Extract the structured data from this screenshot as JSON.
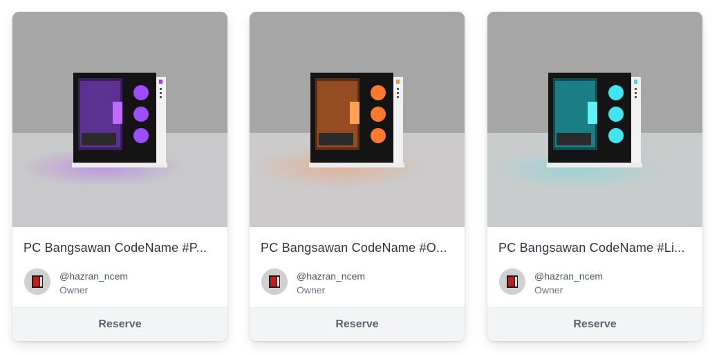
{
  "cards": [
    {
      "title": "PC Bangsawan CodeName #P...",
      "owner_handle": "@hazran_ncem",
      "owner_role": "Owner",
      "button_label": "Reserve",
      "accent": "#a33cff",
      "floor_tint": "#cfcfd8"
    },
    {
      "title": "PC Bangsawan CodeName #O...",
      "owner_handle": "@hazran_ncem",
      "owner_role": "Owner",
      "button_label": "Reserve",
      "accent": "#ff8a3d",
      "floor_tint": "#d6cdca"
    },
    {
      "title": "PC Bangsawan CodeName #Li...",
      "owner_handle": "@hazran_ncem",
      "owner_role": "Owner",
      "button_label": "Reserve",
      "accent": "#36e0ea",
      "floor_tint": "#cdd4d4"
    }
  ]
}
